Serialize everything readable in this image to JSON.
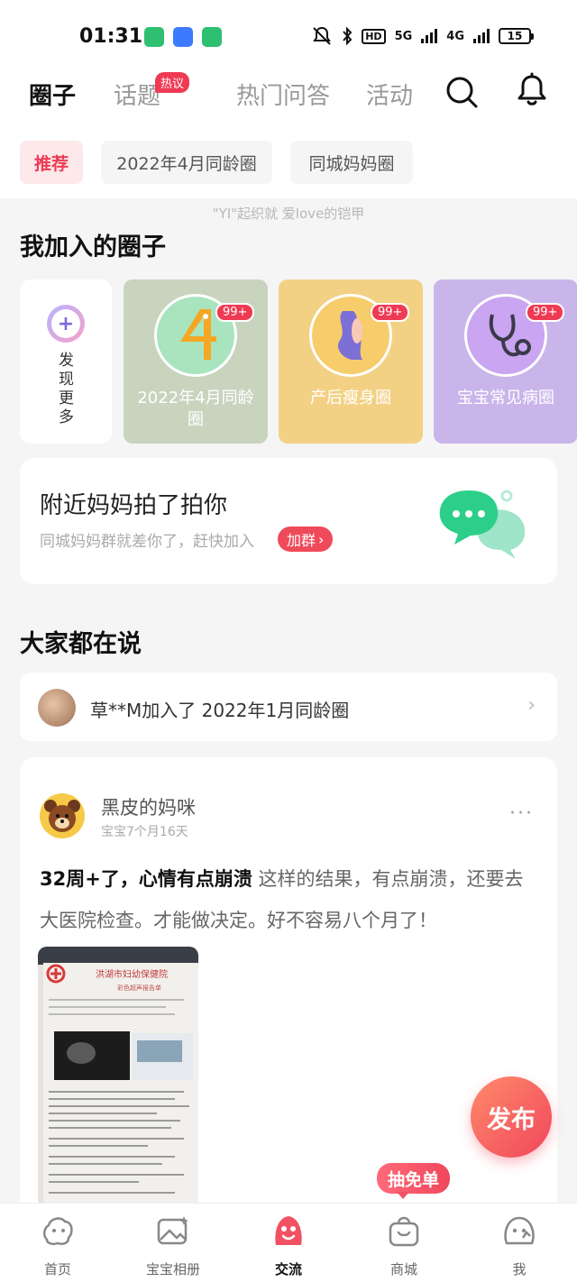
{
  "status_bar": {
    "time": "01:31",
    "battery": "15",
    "network_label": "5G",
    "network_label_2": "4G",
    "hd_label": "HD"
  },
  "top_nav": {
    "tabs": [
      {
        "label": "圈子",
        "active": true
      },
      {
        "label": "话题",
        "active": false
      },
      {
        "label": "热门问答",
        "active": false
      },
      {
        "label": "活动",
        "active": false
      }
    ],
    "hot_badge": "热议",
    "icons": [
      "search-icon",
      "bell-icon"
    ]
  },
  "sub_tabs": [
    {
      "label": "推荐",
      "active": true
    },
    {
      "label": "2022年4月同龄圈",
      "active": false
    },
    {
      "label": "同城妈妈圈",
      "active": false
    }
  ],
  "ticker": "\"YI\"起织就 爱love的铠甲",
  "joined": {
    "title": "我加入的圈子",
    "discover_label": "发现更多",
    "circles": [
      {
        "name": "2022年4月同龄圈",
        "badge": "99+",
        "bg": "#c9d4bf",
        "ring_bg": "#a9e4be"
      },
      {
        "name": "产后瘦身圈",
        "badge": "99+",
        "bg": "#f3d184",
        "ring_bg": "#f6cd6a"
      },
      {
        "name": "宝宝常见病圈",
        "badge": "99+",
        "bg": "#c9b5ea",
        "ring_bg": "#c9a5f2"
      }
    ]
  },
  "nearby": {
    "title": "附近妈妈拍了拍你",
    "subtitle": "同城妈妈群就差你了，赶快加入",
    "join_label": "加群"
  },
  "discussions": {
    "title": "大家都在说",
    "activity_text": "草**M加入了 2022年1月同龄圈"
  },
  "post": {
    "author": "黑皮的妈咪",
    "meta": "宝宝7个月16天",
    "headline": "32周+了，心情有点崩溃",
    "body": "这样的结果，有点崩溃，还要去大医院检查。才能做决定。好不容易八个月了！",
    "more": "···",
    "image_title": "洪湖市妇幼保健院",
    "image_subtitle": "彩色超声报告单"
  },
  "fab_label": "发布",
  "lottery_tag": "抽免单",
  "bottom_nav": [
    {
      "label": "首页",
      "icon": "home-icon",
      "active": false
    },
    {
      "label": "宝宝相册",
      "icon": "album-icon",
      "active": false
    },
    {
      "label": "交流",
      "icon": "community-icon",
      "active": true
    },
    {
      "label": "商城",
      "icon": "shopping-bag-icon",
      "active": false
    },
    {
      "label": "我",
      "icon": "profile-icon",
      "active": false
    }
  ],
  "colors": {
    "accent": "#ef3a53",
    "chip_active_bg": "#fde8ea"
  }
}
